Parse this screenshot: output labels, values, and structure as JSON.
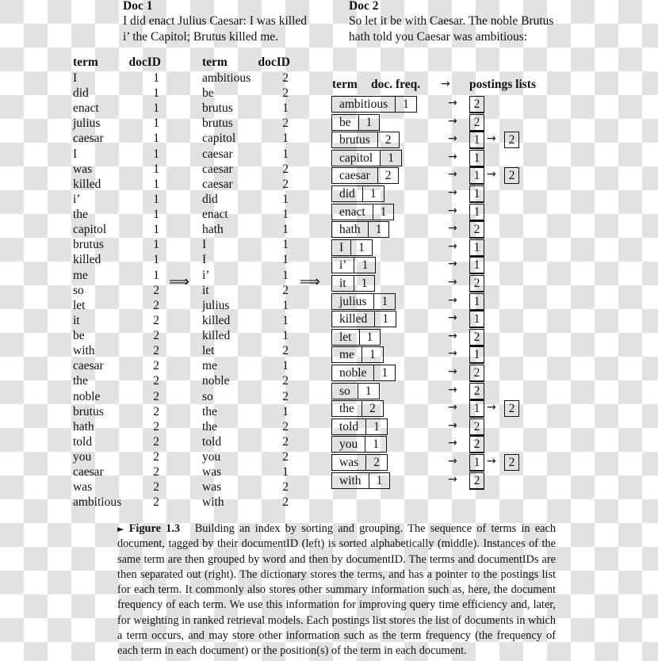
{
  "documents": [
    {
      "title": "Doc 1",
      "lines": [
        "I did enact Julius Caesar: I was killed",
        "i’ the Capitol; Brutus killed me."
      ]
    },
    {
      "title": "Doc 2",
      "lines": [
        "So let it be with Caesar.  The noble Brutus",
        "hath told you Caesar was ambitious:"
      ]
    }
  ],
  "left_table": {
    "headers": {
      "term": "term",
      "docid": "docID"
    },
    "rows": [
      {
        "term": "I",
        "docid": "1"
      },
      {
        "term": "did",
        "docid": "1"
      },
      {
        "term": "enact",
        "docid": "1"
      },
      {
        "term": "julius",
        "docid": "1"
      },
      {
        "term": "caesar",
        "docid": "1"
      },
      {
        "term": "I",
        "docid": "1"
      },
      {
        "term": "was",
        "docid": "1"
      },
      {
        "term": "killed",
        "docid": "1"
      },
      {
        "term": "i’",
        "docid": "1"
      },
      {
        "term": "the",
        "docid": "1"
      },
      {
        "term": "capitol",
        "docid": "1"
      },
      {
        "term": "brutus",
        "docid": "1"
      },
      {
        "term": "killed",
        "docid": "1"
      },
      {
        "term": "me",
        "docid": "1"
      },
      {
        "term": "so",
        "docid": "2"
      },
      {
        "term": "let",
        "docid": "2"
      },
      {
        "term": "it",
        "docid": "2"
      },
      {
        "term": "be",
        "docid": "2"
      },
      {
        "term": "with",
        "docid": "2"
      },
      {
        "term": "caesar",
        "docid": "2"
      },
      {
        "term": "the",
        "docid": "2"
      },
      {
        "term": "noble",
        "docid": "2"
      },
      {
        "term": "brutus",
        "docid": "2"
      },
      {
        "term": "hath",
        "docid": "2"
      },
      {
        "term": "told",
        "docid": "2"
      },
      {
        "term": "you",
        "docid": "2"
      },
      {
        "term": "caesar",
        "docid": "2"
      },
      {
        "term": "was",
        "docid": "2"
      },
      {
        "term": "ambitious",
        "docid": "2"
      }
    ]
  },
  "middle_table": {
    "headers": {
      "term": "term",
      "docid": "docID"
    },
    "rows": [
      {
        "term": "ambitious",
        "docid": "2"
      },
      {
        "term": "be",
        "docid": "2"
      },
      {
        "term": "brutus",
        "docid": "1"
      },
      {
        "term": "brutus",
        "docid": "2"
      },
      {
        "term": "capitol",
        "docid": "1"
      },
      {
        "term": "caesar",
        "docid": "1"
      },
      {
        "term": "caesar",
        "docid": "2"
      },
      {
        "term": "caesar",
        "docid": "2"
      },
      {
        "term": "did",
        "docid": "1"
      },
      {
        "term": "enact",
        "docid": "1"
      },
      {
        "term": "hath",
        "docid": "1"
      },
      {
        "term": "I",
        "docid": "1"
      },
      {
        "term": "I",
        "docid": "1"
      },
      {
        "term": "i’",
        "docid": "1"
      },
      {
        "term": "it",
        "docid": "2"
      },
      {
        "term": "julius",
        "docid": "1"
      },
      {
        "term": "killed",
        "docid": "1"
      },
      {
        "term": "killed",
        "docid": "1"
      },
      {
        "term": "let",
        "docid": "2"
      },
      {
        "term": "me",
        "docid": "1"
      },
      {
        "term": "noble",
        "docid": "2"
      },
      {
        "term": "so",
        "docid": "2"
      },
      {
        "term": "the",
        "docid": "1"
      },
      {
        "term": "the",
        "docid": "2"
      },
      {
        "term": "told",
        "docid": "2"
      },
      {
        "term": "you",
        "docid": "2"
      },
      {
        "term": "was",
        "docid": "1"
      },
      {
        "term": "was",
        "docid": "2"
      },
      {
        "term": "with",
        "docid": "2"
      }
    ]
  },
  "transition_arrow": "⟹",
  "dictionary": {
    "headers": {
      "term": "term",
      "freq": "doc. freq.",
      "arrow": "→",
      "postings": "postings lists"
    },
    "pointer_arrow": "→",
    "entries": [
      {
        "term": "ambitious",
        "freq": "1",
        "postings": [
          "2"
        ]
      },
      {
        "term": "be",
        "freq": "1",
        "postings": [
          "2"
        ]
      },
      {
        "term": "brutus",
        "freq": "2",
        "postings": [
          "1",
          "2"
        ]
      },
      {
        "term": "capitol",
        "freq": "1",
        "postings": [
          "1"
        ]
      },
      {
        "term": "caesar",
        "freq": "2",
        "postings": [
          "1",
          "2"
        ]
      },
      {
        "term": "did",
        "freq": "1",
        "postings": [
          "1"
        ]
      },
      {
        "term": "enact",
        "freq": "1",
        "postings": [
          "1"
        ]
      },
      {
        "term": "hath",
        "freq": "1",
        "postings": [
          "2"
        ]
      },
      {
        "term": "I",
        "freq": "1",
        "postings": [
          "1"
        ]
      },
      {
        "term": "i’",
        "freq": "1",
        "postings": [
          "1"
        ]
      },
      {
        "term": "it",
        "freq": "1",
        "postings": [
          "2"
        ]
      },
      {
        "term": "julius",
        "freq": "1",
        "postings": [
          "1"
        ]
      },
      {
        "term": "killed",
        "freq": "1",
        "postings": [
          "1"
        ]
      },
      {
        "term": "let",
        "freq": "1",
        "postings": [
          "2"
        ]
      },
      {
        "term": "me",
        "freq": "1",
        "postings": [
          "1"
        ]
      },
      {
        "term": "noble",
        "freq": "1",
        "postings": [
          "2"
        ]
      },
      {
        "term": "so",
        "freq": "1",
        "postings": [
          "2"
        ]
      },
      {
        "term": "the",
        "freq": "2",
        "postings": [
          "1",
          "2"
        ]
      },
      {
        "term": "told",
        "freq": "1",
        "postings": [
          "2"
        ]
      },
      {
        "term": "you",
        "freq": "1",
        "postings": [
          "2"
        ]
      },
      {
        "term": "was",
        "freq": "2",
        "postings": [
          "1",
          "2"
        ]
      },
      {
        "term": "with",
        "freq": "1",
        "postings": [
          "2"
        ]
      }
    ]
  },
  "caption": {
    "marker": "►",
    "label": "Figure 1.3",
    "text": "Building an index by sorting and grouping. The sequence of terms in each document, tagged by their documentID (left) is sorted alphabetically (middle). Instances of the same term are then grouped by word and then by documentID. The terms and documentIDs are then separated out (right).  The dictionary stores the terms, and has a pointer to the postings list for each term.  It commonly also stores other summary information such as, here, the document frequency of each term. We use this information for improving query time efficiency and, later, for weighting in ranked retrieval models. Each postings list stores the list of documents in which a term occurs, and may store other information such as the term frequency (the frequency of each term in each document) or the position(s) of the term in each document."
  }
}
